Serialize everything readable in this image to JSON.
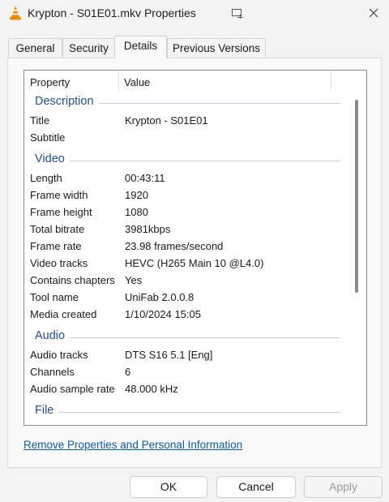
{
  "window": {
    "title": "Krypton - S01E01.mkv Properties"
  },
  "tabs": [
    {
      "label": "General"
    },
    {
      "label": "Security"
    },
    {
      "label": "Details"
    },
    {
      "label": "Previous Versions"
    }
  ],
  "columns": {
    "property": "Property",
    "value": "Value"
  },
  "sections": {
    "description": {
      "label": "Description",
      "rows": [
        {
          "k": "Title",
          "v": "Krypton - S01E01"
        },
        {
          "k": "Subtitle",
          "v": ""
        }
      ]
    },
    "video": {
      "label": "Video",
      "rows": [
        {
          "k": "Length",
          "v": "00:43:11"
        },
        {
          "k": "Frame width",
          "v": "1920"
        },
        {
          "k": "Frame height",
          "v": "1080"
        },
        {
          "k": "Total bitrate",
          "v": "3981kbps"
        },
        {
          "k": "Frame rate",
          "v": "23.98 frames/second"
        },
        {
          "k": "Video tracks",
          "v": "HEVC (H265 Main 10 @L4.0)"
        },
        {
          "k": "Contains chapters",
          "v": "Yes"
        },
        {
          "k": "Tool name",
          "v": "UniFab 2.0.0.8"
        },
        {
          "k": "Media created",
          "v": "1/10/2024 15:05"
        }
      ]
    },
    "audio": {
      "label": "Audio",
      "rows": [
        {
          "k": "Audio tracks",
          "v": "DTS S16 5.1 [Eng]"
        },
        {
          "k": "Channels",
          "v": "6"
        },
        {
          "k": "Audio sample rate",
          "v": "48.000 kHz"
        }
      ]
    },
    "file": {
      "label": "File"
    }
  },
  "link": {
    "remove": "Remove Properties and Personal Information"
  },
  "buttons": {
    "ok": "OK",
    "cancel": "Cancel",
    "apply": "Apply"
  },
  "colors": {
    "accent": "#1f4e9c",
    "link": "#0b5cad",
    "vlc_orange": "#f28a00"
  }
}
